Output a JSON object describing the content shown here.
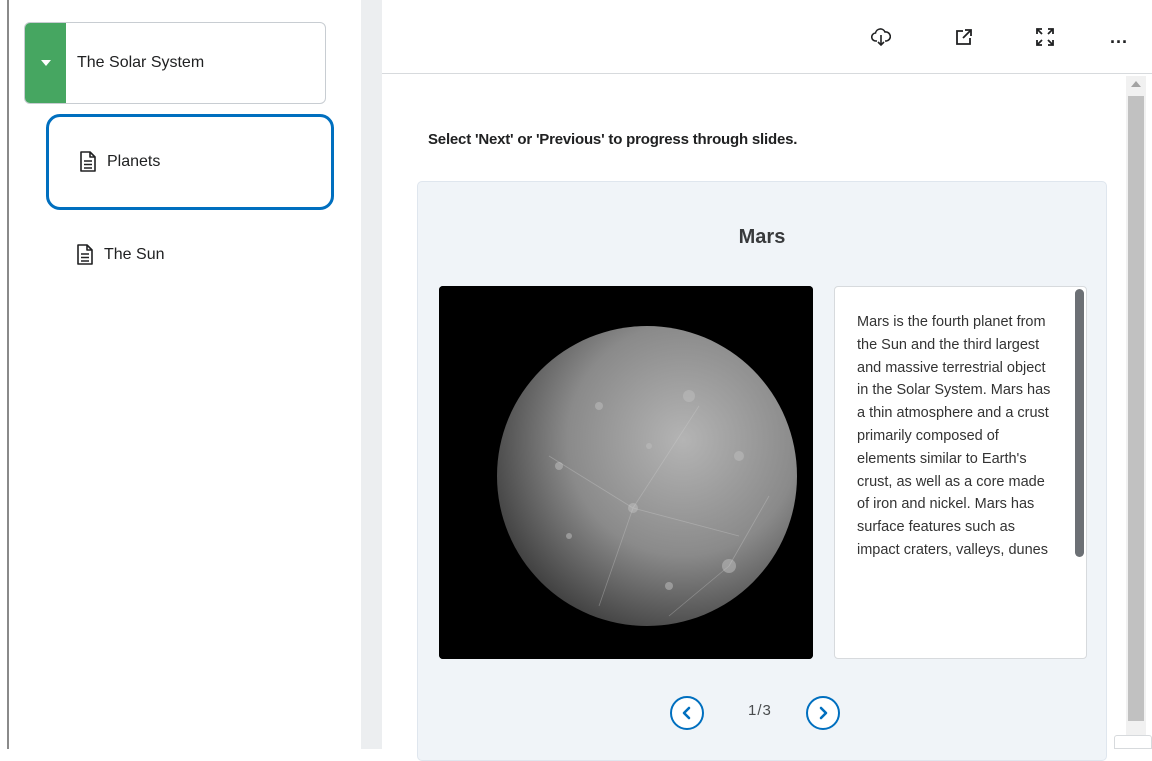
{
  "sidebar": {
    "module": {
      "title": "The Solar System",
      "expanded": true,
      "accent_color": "#46a661"
    },
    "topics": [
      {
        "label": "Planets",
        "selected": true,
        "icon": "document-icon"
      },
      {
        "label": "The Sun",
        "selected": false,
        "icon": "document-icon"
      }
    ]
  },
  "toolbar": {
    "actions": [
      "download-icon",
      "open-new-window-icon",
      "fullscreen-icon",
      "more-options-icon"
    ],
    "more_label": "..."
  },
  "content": {
    "instructions": "Select 'Next' or 'Previous' to progress through slides.",
    "slide": {
      "title": "Mars",
      "text": "Mars is the fourth planet from the Sun and the third largest and massive terrestrial object in the Solar System. Mars has a thin atmosphere and a crust primarily composed of elements similar to Earth's crust, as well as a core made of iron and nickel. Mars has surface features such as impact craters, valleys, dunes"
    },
    "pagination": {
      "current": "1",
      "separator": "/",
      "total": "3",
      "label": "1/3"
    }
  },
  "colors": {
    "accent": "#006fbf",
    "card_bg": "#f0f4f8"
  }
}
